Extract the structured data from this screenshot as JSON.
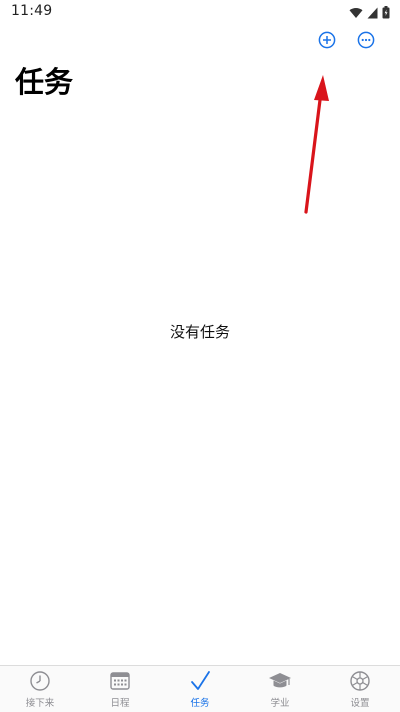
{
  "status_bar": {
    "time": "11:49"
  },
  "header": {
    "title": "任务"
  },
  "main": {
    "empty_message": "没有任务"
  },
  "tab_bar": {
    "tabs": [
      {
        "label": "接下来",
        "icon": "clock-icon",
        "active": false
      },
      {
        "label": "日程",
        "icon": "calendar-icon",
        "active": false
      },
      {
        "label": "任务",
        "icon": "checkmark-icon",
        "active": true
      },
      {
        "label": "学业",
        "icon": "graduation-cap-icon",
        "active": false
      },
      {
        "label": "设置",
        "icon": "gear-icon",
        "active": false
      }
    ]
  },
  "colors": {
    "accent": "#1a73e8",
    "inactive": "#8e8e93",
    "annotation": "#d9141b"
  }
}
